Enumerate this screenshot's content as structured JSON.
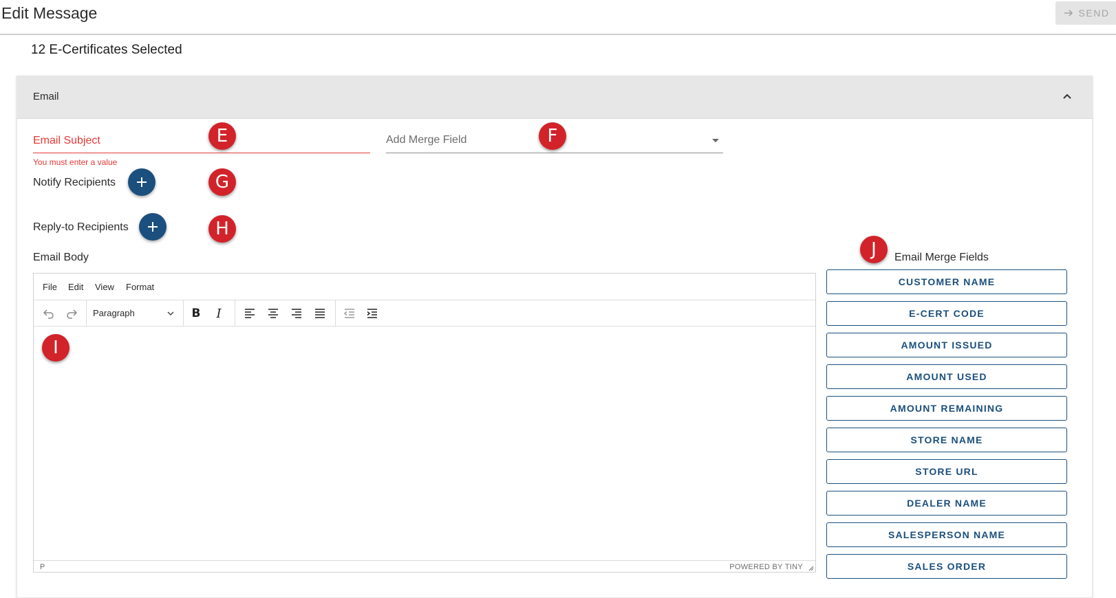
{
  "header": {
    "title": "Edit Message",
    "send_label": "SEND",
    "send_icon": "arrow-right-icon"
  },
  "selection_count": "12 E-Certificates Selected",
  "email_section": {
    "title": "Email",
    "collapse_icon": "chevron-up-icon",
    "subject": {
      "placeholder": "Email Subject",
      "value": "",
      "error": "You must enter a value"
    },
    "merge_field": {
      "placeholder": "Add Merge Field",
      "icon": "caret-down-icon"
    },
    "notify_recipients_label": "Notify Recipients",
    "reply_to_recipients_label": "Reply-to Recipients",
    "body_label": "Email Body"
  },
  "editor": {
    "menu": [
      "File",
      "Edit",
      "View",
      "Format"
    ],
    "block_format": "Paragraph",
    "status_path": "P",
    "branding": "POWERED BY TINY"
  },
  "merge_fields": {
    "title": "Email Merge Fields",
    "buttons": [
      "CUSTOMER NAME",
      "E-CERT CODE",
      "AMOUNT ISSUED",
      "AMOUNT USED",
      "AMOUNT REMAINING",
      "STORE NAME",
      "STORE URL",
      "DEALER NAME",
      "SALESPERSON NAME",
      "SALES ORDER"
    ]
  },
  "markers": [
    "E",
    "F",
    "G",
    "H",
    "I",
    "J"
  ],
  "colors": {
    "primary": "#1b4f7d",
    "error": "#e53935",
    "marker": "#d2232a",
    "header_bg": "#e8e7e8"
  }
}
